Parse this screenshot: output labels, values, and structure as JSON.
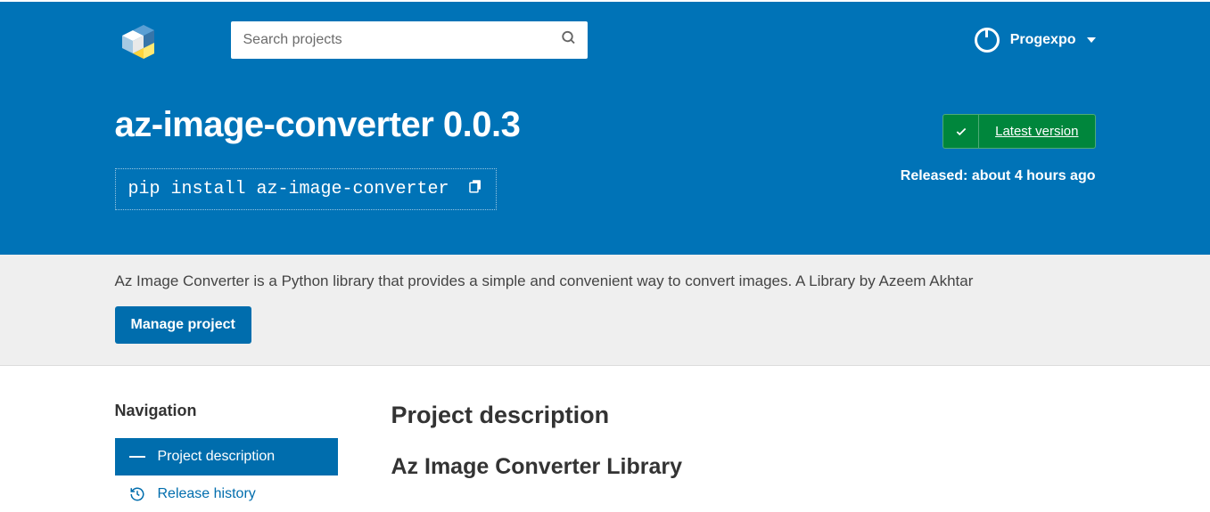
{
  "search": {
    "placeholder": "Search projects"
  },
  "user": {
    "name": "Progexpo"
  },
  "package": {
    "title": "az-image-converter 0.0.3",
    "pip_command": "pip install az-image-converter",
    "badge_label": "Latest version",
    "released_label": "Released: about 4 hours ago",
    "summary": "Az Image Converter is a Python library that provides a simple and convenient way to convert images. A Library by Azeem Akhtar",
    "manage_label": "Manage project"
  },
  "sidebar": {
    "heading": "Navigation",
    "items": [
      {
        "label": "Project description"
      },
      {
        "label": "Release history"
      }
    ]
  },
  "content": {
    "section_title": "Project description",
    "lib_title": "Az Image Converter Library"
  }
}
